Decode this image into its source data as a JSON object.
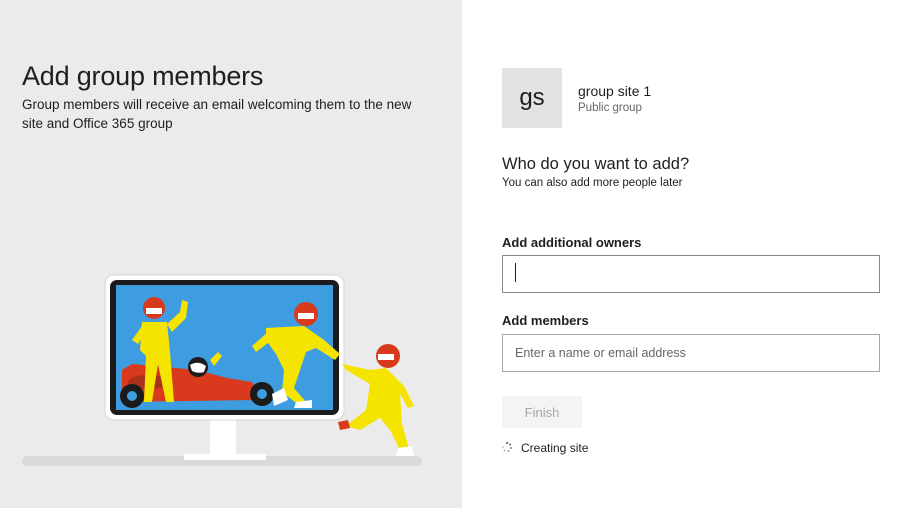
{
  "left": {
    "title": "Add group members",
    "subtitle": "Group members will receive an email welcoming them to the new site and Office 365 group",
    "illustration": "group-members-illustration"
  },
  "site": {
    "initials": "gs",
    "name": "group site 1",
    "type": "Public group"
  },
  "form": {
    "question": "Who do you want to add?",
    "hint": "You can also add more people later",
    "owners_label": "Add additional owners",
    "owners_value": "",
    "members_label": "Add members",
    "members_value": "",
    "members_placeholder": "Enter a name or email address",
    "finish_label": "Finish",
    "status_text": "Creating site",
    "status_icon": "spinner-icon"
  },
  "colors": {
    "left_background": "#ebebeb",
    "tile_background": "#e3e3e3",
    "button_disabled_text": "#a6a6a6",
    "figure_yellow": "#f5e400",
    "figure_red": "#d9391c",
    "screen_blue": "#3d9de0"
  }
}
